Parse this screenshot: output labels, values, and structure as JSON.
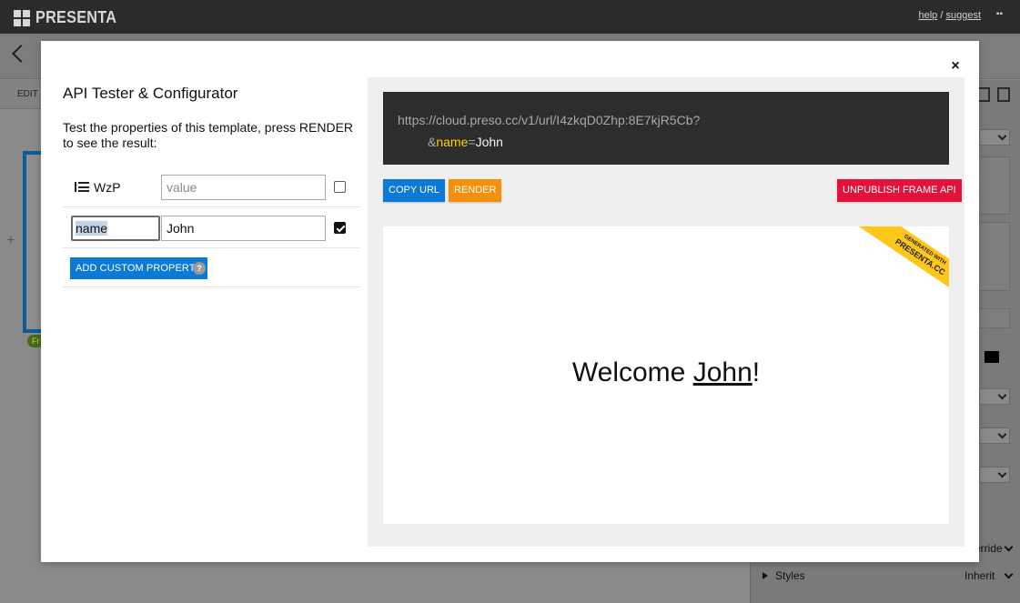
{
  "app": {
    "name": "PRESENTA",
    "links": {
      "help": "help",
      "separator": "/",
      "suggest": "suggest"
    },
    "edit_label": "EDIT I",
    "tag": "Fr",
    "styles_label": "Styles",
    "styles_value": "Inherit",
    "override_label": "erride"
  },
  "modal": {
    "title": "API Tester & Configurator",
    "description": "Test the properties of this template, press RENDER to see the result:",
    "close_glyph": "×",
    "properties": [
      {
        "label": "WzP",
        "value": "",
        "placeholder": "value",
        "checked": false
      },
      {
        "key": "name",
        "value": "John",
        "checked": true
      }
    ],
    "add_button": "ADD CUSTOM PROPERTY",
    "help_glyph": "?"
  },
  "preview": {
    "url_base": "https://cloud.preso.cc/v1/url/I4zkqD0Zhp:8E7kjR5Cb?",
    "param_amp": "&",
    "param_key": "name",
    "param_eq": "=",
    "param_value": "John",
    "buttons": {
      "copy": "COPY URL",
      "render": "RENDER",
      "unpublish": "UNPUBLISH FRAME API"
    },
    "ribbon_small": "GENERATED WITH",
    "ribbon_big": "PRESENTA.CC",
    "welcome_prefix": "Welcome ",
    "welcome_name": "John",
    "welcome_suffix": "!"
  },
  "colors": {
    "copy_button": "#0b7ad6",
    "render_button": "#f4900c",
    "unpublish_button": "#e3123a",
    "param_key": "#ffd600",
    "ribbon": "#ffc61a"
  }
}
